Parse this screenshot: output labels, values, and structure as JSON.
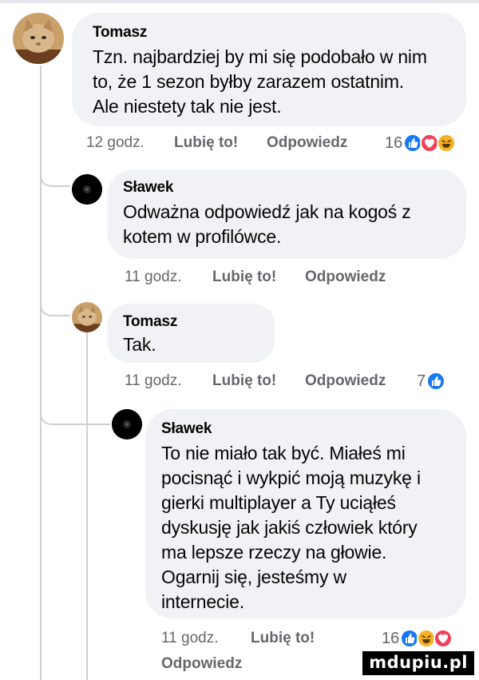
{
  "comments": [
    {
      "author": "Tomasz",
      "text": "Tzn. najbardziej by mi się podobało w nim\nto, że 1 sezon byłby zarazem ostatnim.\nAle niestety tak nie jest.",
      "time": "12 godz.",
      "like_label": "Lubię to!",
      "reply_label": "Odpowiedz",
      "reaction_count": "16",
      "reactions": [
        "like",
        "love",
        "haha"
      ]
    },
    {
      "author": "Sławek",
      "text": "Odważna odpowiedź jak na kogoś z\nkotem w profilówce.",
      "time": "11 godz.",
      "like_label": "Lubię to!",
      "reply_label": "Odpowiedz"
    },
    {
      "author": "Tomasz",
      "text": "Tak.",
      "time": "11 godz.",
      "like_label": "Lubię to!",
      "reply_label": "Odpowiedz",
      "reaction_count": "7",
      "reactions": [
        "like"
      ]
    },
    {
      "author": "Sławek",
      "text": "To nie miało tak być. Miałeś mi\npocisnąć i wykpić moją muzykę i\ngierki multiplayer a Ty uciąłeś\ndyskusję jak jakiś człowiek który\nma lepsze rzeczy na głowie.\nOgarnij się, jesteśmy w\ninternecie.",
      "time": "11 godz.",
      "like_label": "Lubię to!",
      "reply_label": "Odpowiedz",
      "reaction_count": "16",
      "reactions": [
        "like",
        "haha",
        "love"
      ]
    }
  ],
  "watermark": "mdupiu.pl",
  "colors": {
    "bubble": "#f0f2f5",
    "meta_text": "#65676b",
    "like_blue": "#1877f2",
    "love_red": "#f33e58",
    "haha_yellow": "#f7b125",
    "thread_line": "#ccd0d5"
  }
}
